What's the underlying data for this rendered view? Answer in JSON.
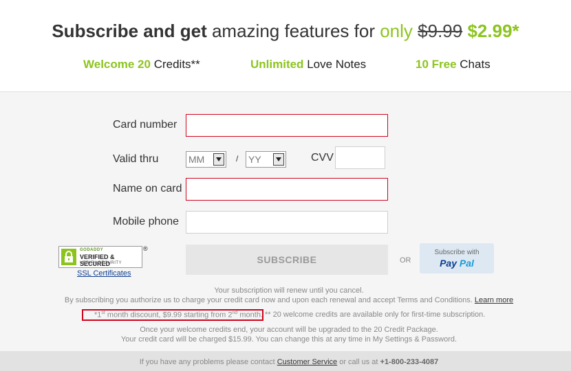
{
  "headline": {
    "part1": "Subscribe and get",
    "part2": "amazing features for",
    "part3": "only",
    "old_price": "$9.99",
    "new_price": "$2.99*"
  },
  "features": [
    {
      "highlight": "Welcome 20",
      "text": "Credits**"
    },
    {
      "highlight": "Unlimited",
      "text": "Love Notes"
    },
    {
      "highlight": "10 Free",
      "text": "Chats"
    }
  ],
  "form": {
    "card_number_label": "Card number",
    "valid_thru_label": "Valid thru",
    "month_value": "MM",
    "slash": "/",
    "year_value": "YY",
    "cvv_label": "CVV",
    "name_label": "Name on card",
    "phone_label": "Mobile phone"
  },
  "badge": {
    "brand": "GODADDY",
    "title": "VERIFIED & SECURED",
    "sub": "VERIFY SECURITY",
    "reg": "®",
    "ssl_link": "SSL Certificates"
  },
  "subscribe_label": "SUBSCRIBE",
  "or_label": "OR",
  "paypal": {
    "subscribe_with": "Subscribe with",
    "pay": "Pay",
    "pal": "Pal"
  },
  "fine_print": {
    "renew": "Your subscription will renew until you cancel.",
    "authorize": "By subscribing you authorize us to charge your credit card now and upon each renewal and accept Terms and Conditions.",
    "learn_more": "Learn more",
    "disc_a": "*1",
    "disc_sup1": "st",
    "disc_b": " month discount, $9.99 starting from 2",
    "disc_sup2": "nd",
    "disc_c": " month.",
    "credits_note": "** 20 welcome credits are available only for first-time subscription.",
    "upgrade": "Once your welcome credits end, your account will be upgraded to the 20 Credit Package.",
    "charge": "Your credit card will be charged $15.99. You can change this at any time in My Settings & Password."
  },
  "footer": {
    "text1": "If you have any problems please contact",
    "link": "Customer Service",
    "text2": "or call us at",
    "phone": "+1-800-233-4087"
  },
  "colors": {
    "accent_green": "#8cc41e",
    "error_red": "#d0021b",
    "paypal_bg": "#dde8f3"
  }
}
